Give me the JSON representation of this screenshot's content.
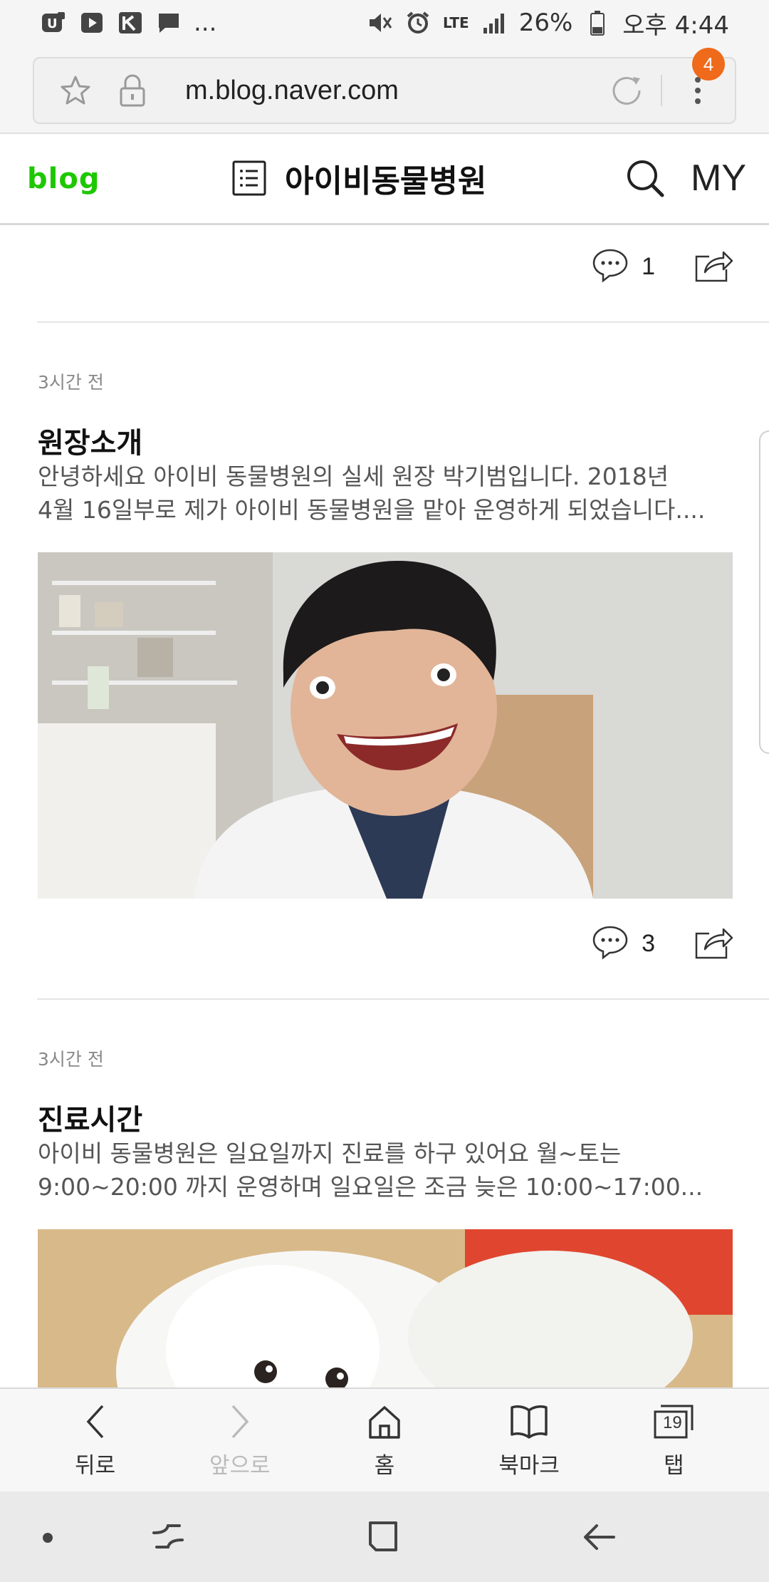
{
  "status_bar": {
    "left_more": "...",
    "network": "LTE",
    "battery": "26%",
    "time": "오후 4:44"
  },
  "browser": {
    "url": "m.blog.naver.com",
    "tab_badge": "4"
  },
  "blog_header": {
    "logo": "blog",
    "title": "아이비동물병원",
    "my_label": "MY"
  },
  "posts": [
    {
      "comment_count": "1"
    },
    {
      "time": "3시간 전",
      "title": "원장소개",
      "excerpt_line1": "안녕하세요 아이비 동물병원의 실세 원장 박기범입니다. 2018년",
      "excerpt_line2": "4월 16일부로 제가 아이비 동물병원을 맡아 운영하게 되었습니다....",
      "comment_count": "3"
    },
    {
      "time": "3시간 전",
      "title": "진료시간",
      "excerpt_line1": "아이비 동물병원은 일요일까지 진료를 하구 있어요 월~토는",
      "excerpt_line2": "9:00~20:00 까지 운영하며 일요일은 조금 늦은 10:00~17:00..."
    }
  ],
  "toolbar": {
    "back": "뒤로",
    "forward": "앞으로",
    "home": "홈",
    "bookmark": "북마크",
    "tabs": "탭",
    "tab_count": "19"
  },
  "colors": {
    "naver_green": "#1ec800",
    "badge_orange": "#ef6a1a"
  }
}
